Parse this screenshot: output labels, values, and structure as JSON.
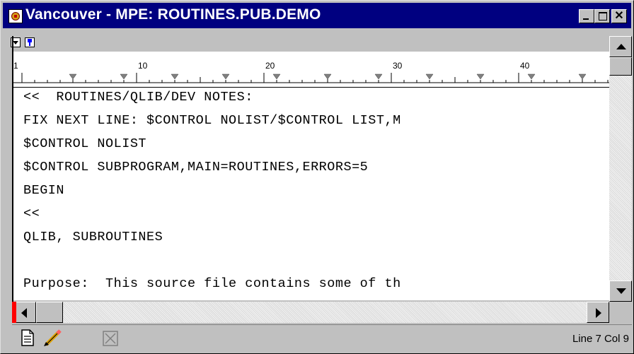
{
  "window": {
    "title": "Vancouver - MPE: ROUTINES.PUB.DEMO"
  },
  "ruler": {
    "labels": [
      "1",
      "10",
      "20",
      "30",
      "40"
    ]
  },
  "editor": {
    "lines": [
      "<<  ROUTINES/QLIB/DEV NOTES:",
      "FIX NEXT LINE: $CONTROL NOLIST/$CONTROL LIST,M",
      "$CONTROL NOLIST",
      "$CONTROL SUBPROGRAM,MAIN=ROUTINES,ERRORS=5",
      "BEGIN",
      "<<",
      "QLIB, SUBROUTINES",
      "",
      "Purpose:  This source file contains some of th"
    ]
  },
  "status": {
    "position": "Line 7 Col 9"
  },
  "icons": {
    "app": "vancouver-app-icon",
    "document": "document-icon",
    "edit": "pencil-icon",
    "disabled": "disabled-x-icon"
  },
  "colors": {
    "titlebar": "#000080",
    "marker": "#ff0000"
  }
}
